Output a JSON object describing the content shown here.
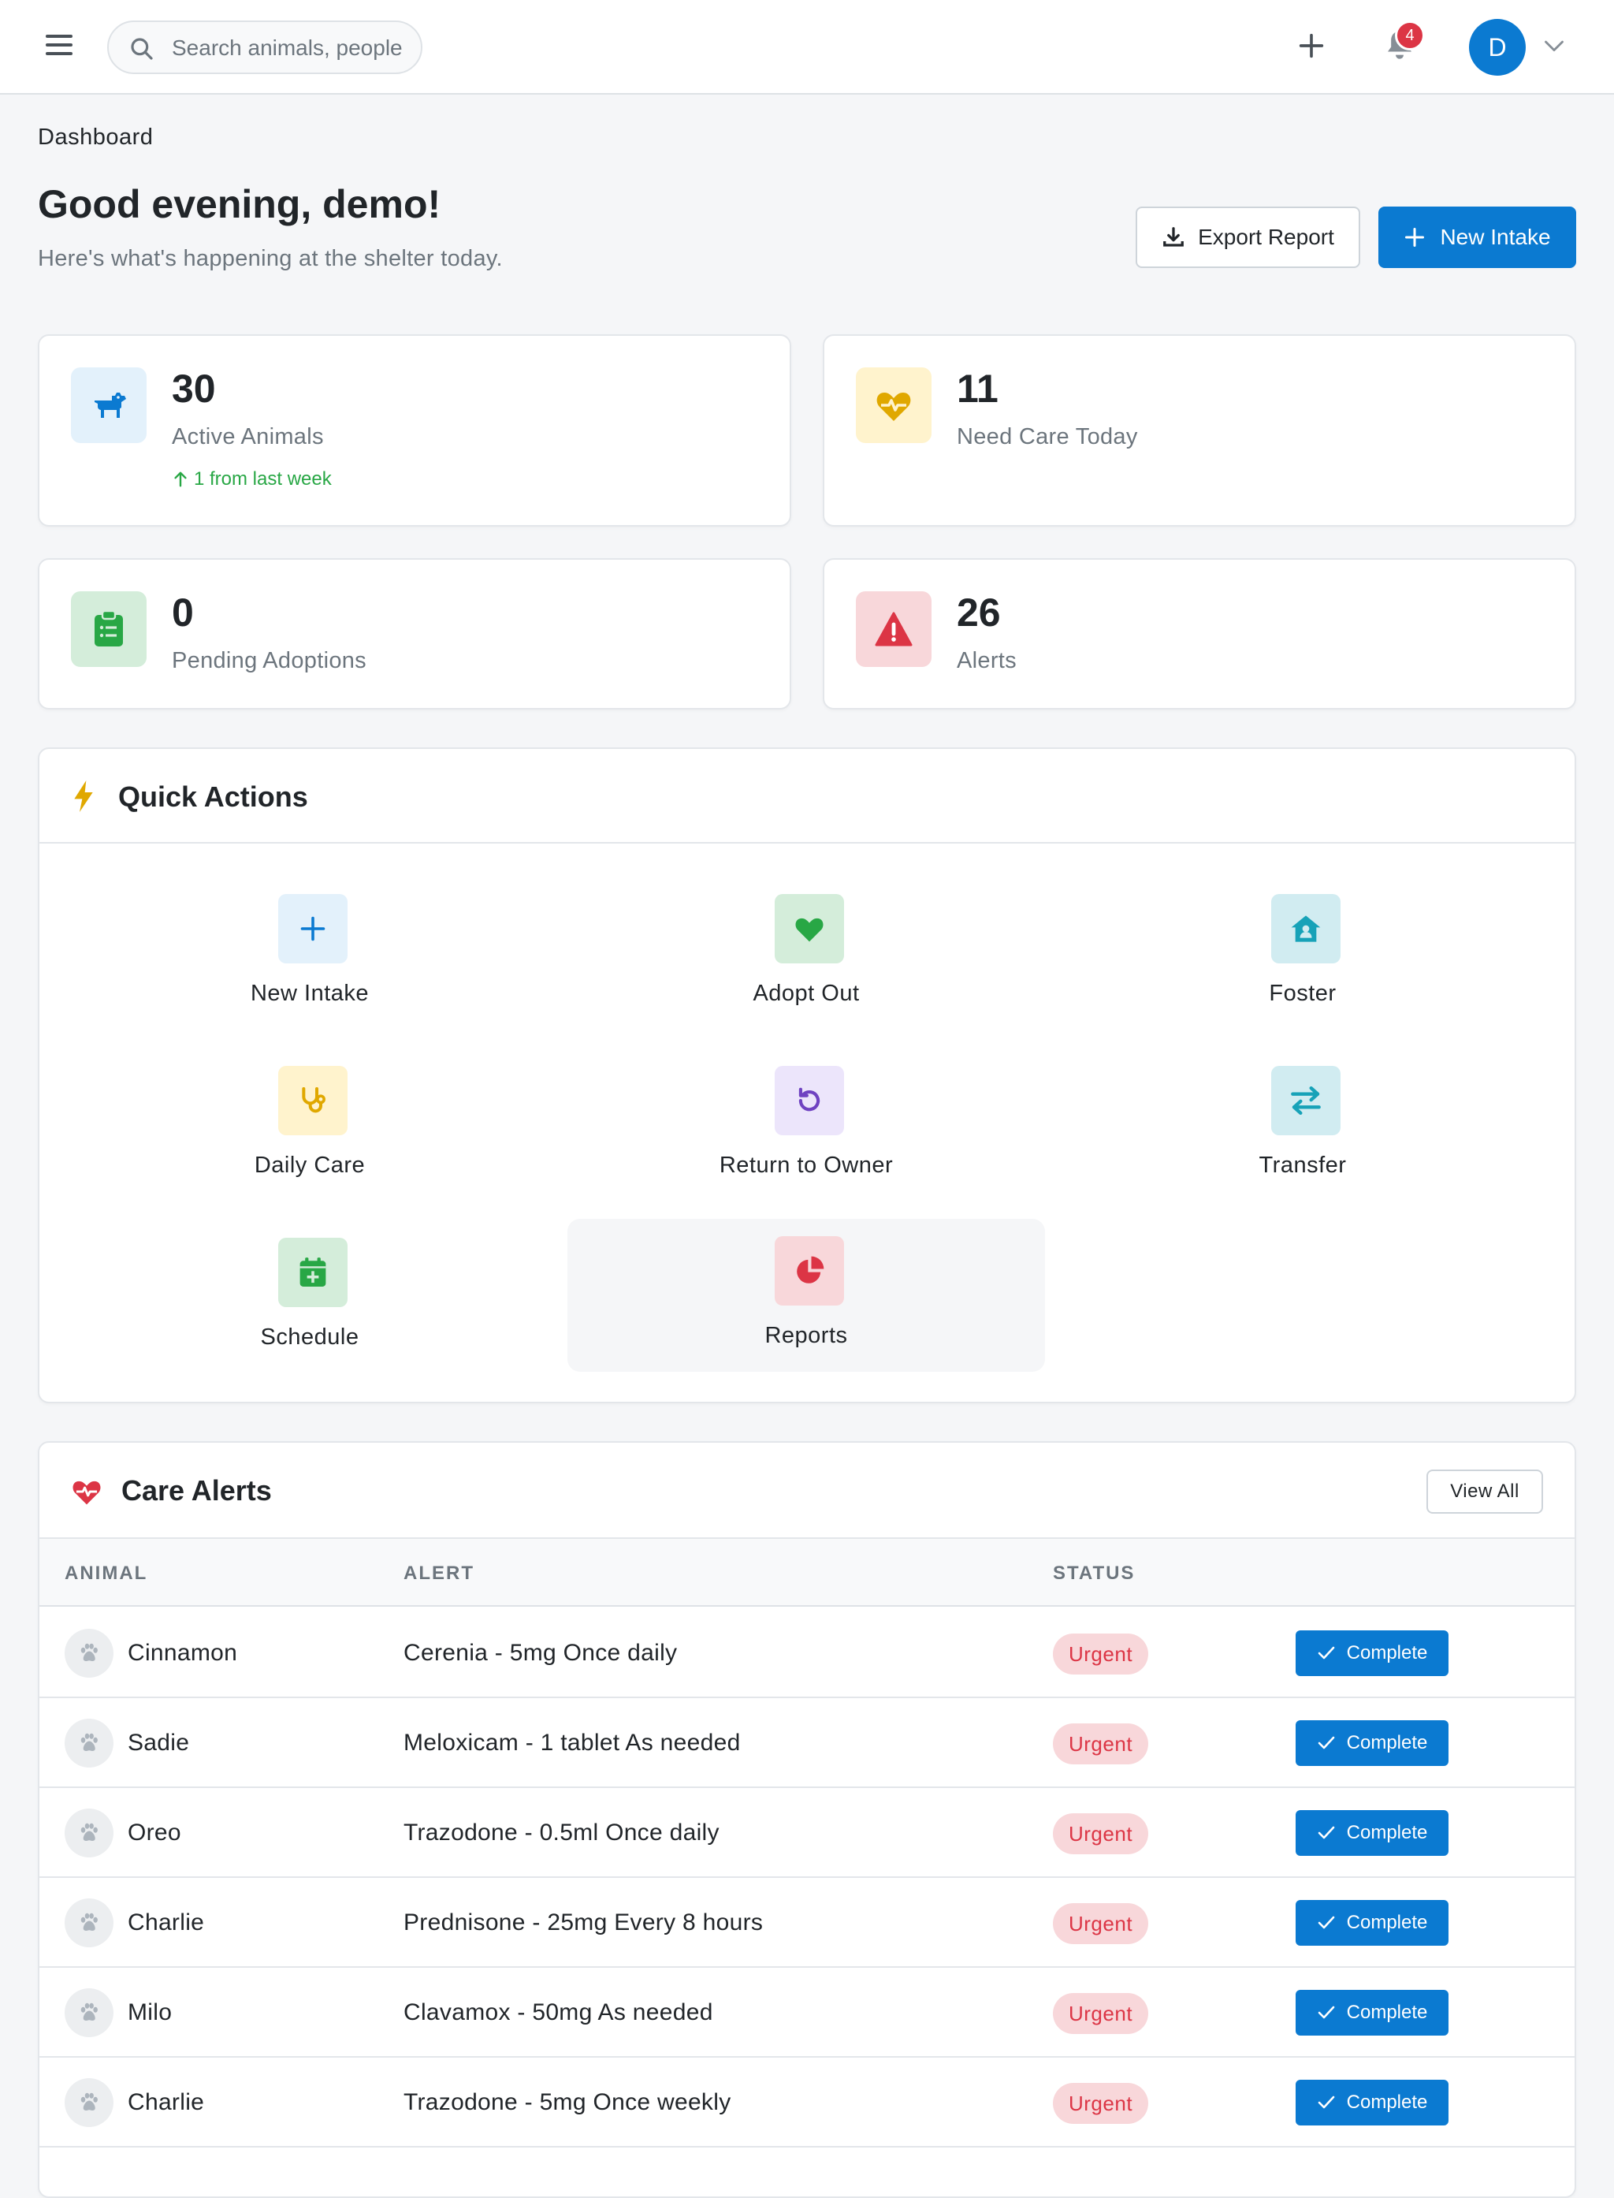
{
  "topbar": {
    "menu_icon": "hamburger-menu-icon",
    "search_placeholder": "Search animals, people",
    "notification_count": "4",
    "avatar_initial": "D",
    "brand_color": "#0b7ad1"
  },
  "breadcrumb": "Dashboard",
  "header": {
    "greeting": "Good evening, demo!",
    "subtitle": "Here's what's happening at the shelter today.",
    "export_label": "Export Report",
    "new_intake_label": "New Intake"
  },
  "stats": [
    {
      "value": "30",
      "label": "Active Animals",
      "trend": "1 from last week",
      "icon": "dog-icon",
      "color": "#0b7ad1",
      "bg": "#e3f1fb"
    },
    {
      "value": "11",
      "label": "Need Care Today",
      "icon": "heart-pulse-icon",
      "color": "#e0a800",
      "bg": "#fff3cd"
    },
    {
      "value": "0",
      "label": "Pending Adoptions",
      "icon": "clipboard-list-icon",
      "color": "#28a745",
      "bg": "#d4edda"
    },
    {
      "value": "26",
      "label": "Alerts",
      "icon": "warning-triangle-icon",
      "color": "#dc3545",
      "bg": "#f8d7da"
    }
  ],
  "quick_actions": {
    "title": "Quick Actions",
    "items": [
      {
        "label": "New Intake",
        "icon": "plus-icon",
        "color": "#0b7ad1",
        "bg": "#e3f1fb"
      },
      {
        "label": "Adopt Out",
        "icon": "heart-icon",
        "color": "#28a745",
        "bg": "#d4edda"
      },
      {
        "label": "Foster",
        "icon": "house-user-icon",
        "color": "#17a2b8",
        "bg": "#d1ecf1"
      },
      {
        "label": "Daily Care",
        "icon": "stethoscope-icon",
        "color": "#e0a800",
        "bg": "#fff3cd"
      },
      {
        "label": "Return to Owner",
        "icon": "undo-icon",
        "color": "#6f42c1",
        "bg": "#ece5fb"
      },
      {
        "label": "Transfer",
        "icon": "exchange-icon",
        "color": "#17a2b8",
        "bg": "#d1ecf1"
      },
      {
        "label": "Schedule",
        "icon": "calendar-plus-icon",
        "color": "#28a745",
        "bg": "#d4edda"
      },
      {
        "label": "Reports",
        "icon": "pie-chart-icon",
        "color": "#dc3545",
        "bg": "#f8d7da"
      }
    ]
  },
  "care_alerts": {
    "title": "Care Alerts",
    "view_all": "View All",
    "columns": [
      "ANIMAL",
      "ALERT",
      "STATUS"
    ],
    "complete_label": "Complete",
    "rows": [
      {
        "animal": "Cinnamon",
        "alert": "Cerenia - 5mg Once daily",
        "status": "Urgent"
      },
      {
        "animal": "Sadie",
        "alert": "Meloxicam - 1 tablet As needed",
        "status": "Urgent"
      },
      {
        "animal": "Oreo",
        "alert": "Trazodone - 0.5ml Once daily",
        "status": "Urgent"
      },
      {
        "animal": "Charlie",
        "alert": "Prednisone - 25mg Every 8 hours",
        "status": "Urgent"
      },
      {
        "animal": "Milo",
        "alert": "Clavamox - 50mg As needed",
        "status": "Urgent"
      },
      {
        "animal": "Charlie",
        "alert": "Trazodone - 5mg Once weekly",
        "status": "Urgent"
      }
    ]
  }
}
